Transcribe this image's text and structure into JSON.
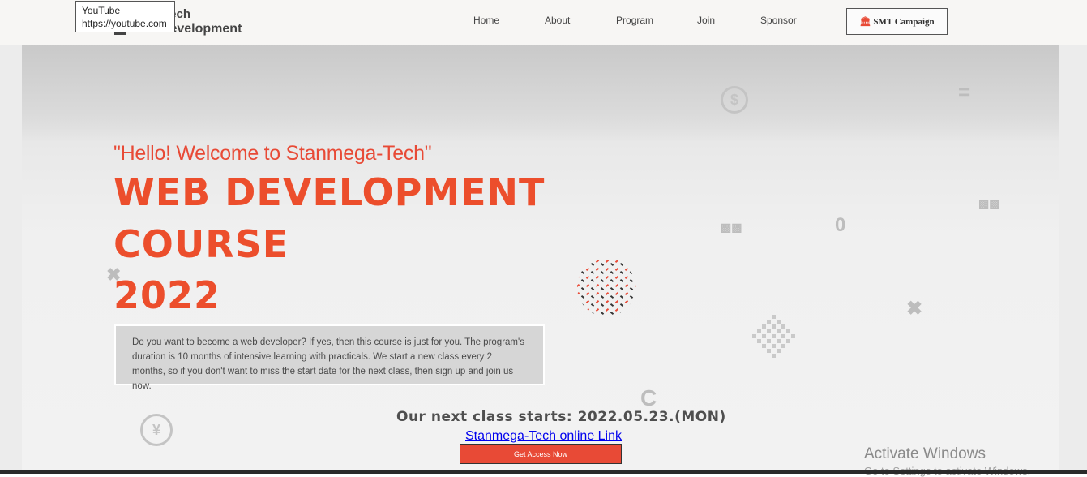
{
  "tooltip": {
    "title": "YouTube",
    "url": "https://youtube.com"
  },
  "logo": {
    "line1": "mega-tech",
    "line2": "Web Development"
  },
  "nav": {
    "items": [
      "Home",
      "About",
      "Program",
      "Join",
      "Sponsor"
    ]
  },
  "campaign_button": {
    "label": "SMT Campaign",
    "icon": "bank-icon"
  },
  "hero": {
    "hello": "\"Hello! Welcome to Stanmega-Tech\"",
    "title_line1": "WEB DEVELOPMENT",
    "title_line2": "COURSE",
    "title_line3": "2022",
    "description": "Do you want to become a web developer? If yes, then this course is just for you. The program's duration is 10 months of intensive learning with practicals. We start a new class every 2 months, so if you don't want to miss the start date for the next class, then sign up and join us now.",
    "next_class": "Our next class starts: 2022.05.23.(MON)",
    "link_text": "Stanmega-Tech online Link",
    "cta_label": "Get Access Now"
  },
  "watermark": {
    "line1": "Activate Windows",
    "line2": "Go to Settings to activate Windows."
  },
  "colors": {
    "accent": "#e84a36",
    "title": "#ec4e2c",
    "link": "#0000ee"
  }
}
